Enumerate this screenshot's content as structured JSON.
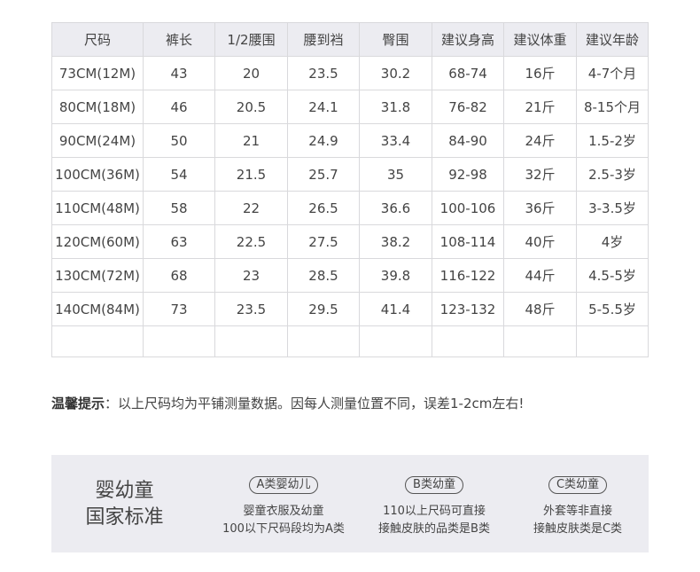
{
  "table": {
    "headers": [
      "尺码",
      "裤长",
      "1/2腰围",
      "腰到裆",
      "臀围",
      "建议身高",
      "建议体重",
      "建议年龄"
    ],
    "rows": [
      [
        "73CM(12M)",
        "43",
        "20",
        "23.5",
        "30.2",
        "68-74",
        "16斤",
        "4-7个月"
      ],
      [
        "80CM(18M)",
        "46",
        "20.5",
        "24.1",
        "31.8",
        "76-82",
        "21斤",
        "8-15个月"
      ],
      [
        "90CM(24M)",
        "50",
        "21",
        "24.9",
        "33.4",
        "84-90",
        "24斤",
        "1.5-2岁"
      ],
      [
        "100CM(36M)",
        "54",
        "21.5",
        "25.7",
        "35",
        "92-98",
        "32斤",
        "2.5-3岁"
      ],
      [
        "110CM(48M)",
        "58",
        "22",
        "26.5",
        "36.6",
        "100-106",
        "36斤",
        "3-3.5岁"
      ],
      [
        "120CM(60M)",
        "63",
        "22.5",
        "27.5",
        "38.2",
        "108-114",
        "40斤",
        "4岁"
      ],
      [
        "130CM(72M)",
        "68",
        "23",
        "28.5",
        "39.8",
        "116-122",
        "44斤",
        "4.5-5岁"
      ],
      [
        "140CM(84M)",
        "73",
        "23.5",
        "29.5",
        "41.4",
        "123-132",
        "48斤",
        "5-5.5岁"
      ]
    ]
  },
  "tip": {
    "label": "温馨提示",
    "text": "：以上尺码均为平铺测量数据。因每人测量位置不同，误差1-2cm左右!"
  },
  "standard": {
    "title_line1": "婴幼童",
    "title_line2": "国家标准",
    "columns": [
      {
        "badge": "A类婴幼儿",
        "line1": "婴童衣服及幼童",
        "line2": "100以下尺码段均为A类"
      },
      {
        "badge": "B类幼童",
        "line1": "110以上尺码可直接",
        "line2": "接触皮肤的品类是B类"
      },
      {
        "badge": "C类幼童",
        "line1": "外套等非直接",
        "line2": "接触皮肤类是C类"
      }
    ]
  }
}
